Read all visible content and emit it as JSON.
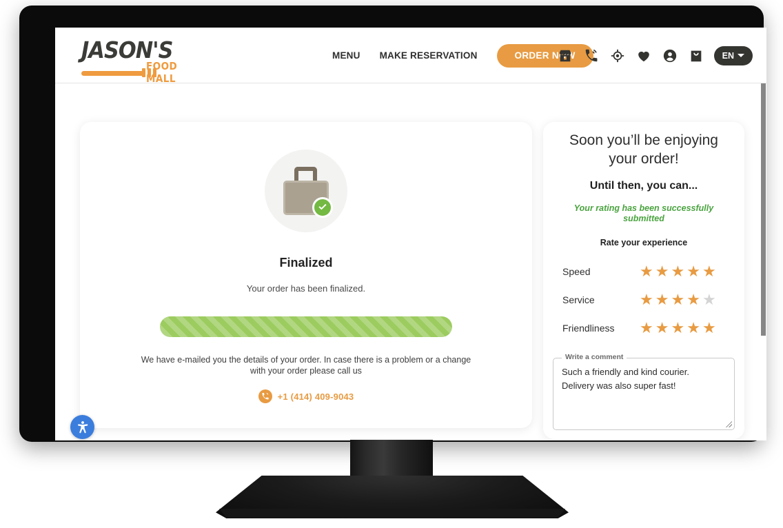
{
  "header": {
    "logo": {
      "word": "JASON'S",
      "sub": "FOOD MALL",
      "icon": "fork-icon"
    },
    "nav": [
      {
        "label": "MENU",
        "name": "nav-menu"
      },
      {
        "label": "MAKE RESERVATION",
        "name": "nav-make-reservation"
      }
    ],
    "order_now_label": "ORDER NOW",
    "icons": [
      {
        "name": "store-icon",
        "title": "store"
      },
      {
        "name": "phone-call-icon",
        "title": "call"
      },
      {
        "name": "location-target-icon",
        "title": "locations"
      },
      {
        "name": "heart-icon",
        "title": "favorites"
      },
      {
        "name": "account-icon",
        "title": "account"
      },
      {
        "name": "shopping-bag-icon",
        "title": "cart"
      }
    ],
    "language": {
      "label": "EN",
      "caret": "chevron-down-icon"
    },
    "accent_color": "#e89b42",
    "icon_color": "#343431"
  },
  "order_status": {
    "illustration": "shopping-bag-with-check-icon",
    "title": "Finalized",
    "subtitle": "Your order has been finalized.",
    "progress_percent": 100,
    "progress_color": "#9ccc5f",
    "email_note": "We have e-mailed you the details of your order. In case there is a problem or a change with your order please call us",
    "phone_icon": "phone-call-icon",
    "phone": "+1 (414) 409-9043",
    "phone_color": "#e89b42"
  },
  "review_panel": {
    "heading": "Soon you’ll be enjoying your order!",
    "subheading": "Until then, you can...",
    "success_message": "Your rating has been successfully submitted",
    "success_color": "#4aa33f",
    "rate_label": "Rate your experience",
    "max_stars": 5,
    "star_on_color": "#e89b42",
    "star_off_color": "#d4d4d4",
    "ratings": [
      {
        "name": "Speed",
        "value": 5
      },
      {
        "name": "Service",
        "value": 4
      },
      {
        "name": "Friendliness",
        "value": 5
      }
    ],
    "comment": {
      "legend": "Write a comment",
      "value": "Such a friendly and kind courier.\nDelivery was also super fast!",
      "placeholder": ""
    }
  },
  "accessibility": {
    "name": "accessibility-button",
    "icon": "accessibility-icon",
    "color": "#3b7ddd"
  },
  "scrollbar": {
    "name": "page-scrollbar",
    "thumb_color": "#868686"
  }
}
